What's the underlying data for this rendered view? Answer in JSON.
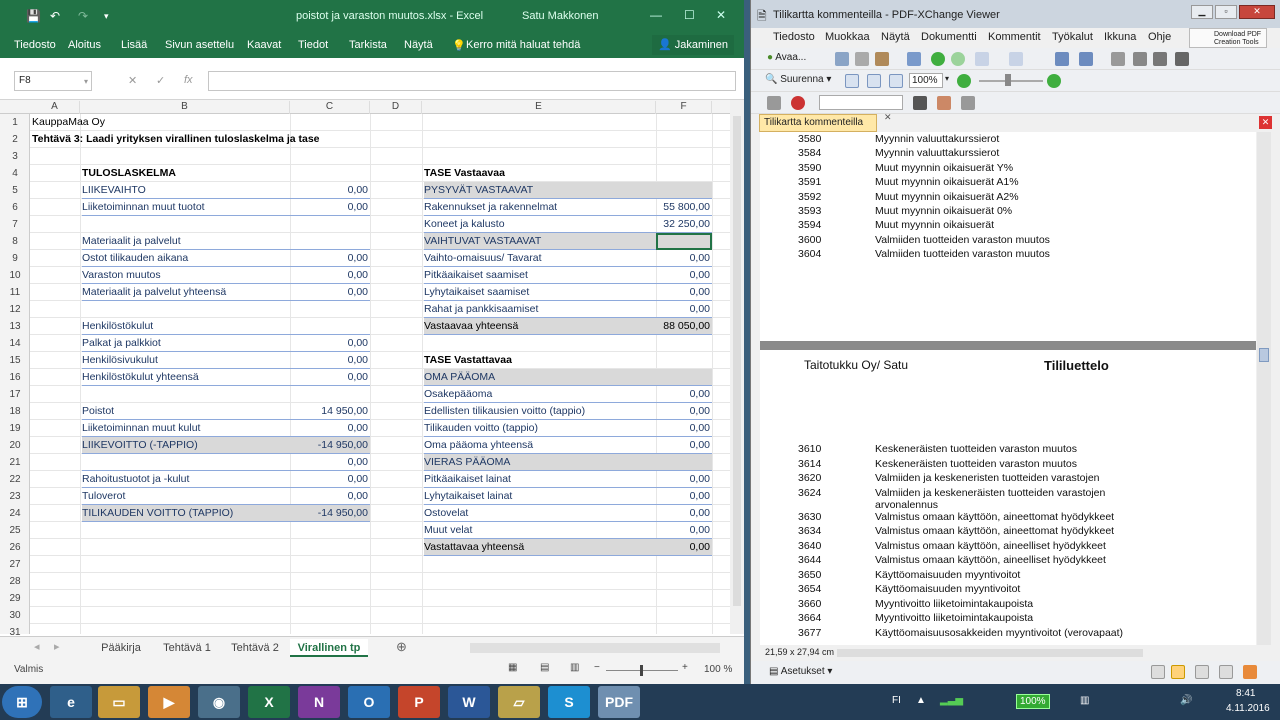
{
  "excel": {
    "title": "poistot ja varaston muutos.xlsx - Excel",
    "user": "Satu Makkonen",
    "ribbon_tabs": [
      "Tiedosto",
      "Aloitus",
      "Lisää",
      "Sivun asettelu",
      "Kaavat",
      "Tiedot",
      "Tarkista",
      "Näytä"
    ],
    "tell_me": "Kerro mitä haluat tehdä",
    "share": "Jakaminen",
    "name_box": "F8",
    "fx_label": "fx",
    "columns": [
      "A",
      "B",
      "C",
      "D",
      "E",
      "F"
    ],
    "rows": [
      "1",
      "2",
      "3",
      "4",
      "5",
      "6",
      "7",
      "8",
      "9",
      "10",
      "11",
      "12",
      "13",
      "14",
      "15",
      "16",
      "17",
      "18",
      "19",
      "20",
      "21",
      "22",
      "23",
      "24",
      "25",
      "26",
      "27",
      "28",
      "29",
      "30",
      "31"
    ],
    "a1": "KauppaMaa Oy",
    "a2": "Tehtävä 3: Laadi yrityksen virallinen tuloslaskelma ja tase",
    "income_header": "TULOSLASKELMA",
    "income": [
      {
        "label": "LIIKEVAIHTO",
        "value": "0,00"
      },
      {
        "label": "Liiketoiminnan muut tuotot",
        "value": "0,00"
      },
      {
        "label": "",
        "value": ""
      },
      {
        "label": "Materiaalit ja palvelut",
        "value": ""
      },
      {
        "label": "Ostot tilikauden aikana",
        "value": "0,00"
      },
      {
        "label": "Varaston muutos",
        "value": "0,00"
      },
      {
        "label": "Materiaalit ja palvelut yhteensä",
        "value": "0,00"
      },
      {
        "label": "",
        "value": ""
      },
      {
        "label": "Henkilöstökulut",
        "value": ""
      },
      {
        "label": "Palkat ja palkkiot",
        "value": "0,00"
      },
      {
        "label": "Henkilösivukulut",
        "value": "0,00"
      },
      {
        "label": "Henkilöstökulut yhteensä",
        "value": "0,00"
      },
      {
        "label": "",
        "value": ""
      },
      {
        "label": "Poistot",
        "value": "14 950,00"
      },
      {
        "label": "Liiketoiminnan muut kulut",
        "value": "0,00"
      },
      {
        "label": "LIIKEVOITTO (-TAPPIO)",
        "value": "-14 950,00"
      },
      {
        "label": "",
        "value": "0,00"
      },
      {
        "label": "Rahoitustuotot ja -kulut",
        "value": "0,00"
      },
      {
        "label": "Tuloverot",
        "value": "0,00"
      },
      {
        "label": "TILIKAUDEN VOITTO (TAPPIO)",
        "value": "-14 950,00"
      }
    ],
    "assets_header": "TASE Vastaavaa",
    "assets": [
      {
        "label": "PYSYVÄT VASTAAVAT",
        "value": ""
      },
      {
        "label": "Rakennukset ja rakennelmat",
        "value": "55 800,00"
      },
      {
        "label": "Koneet ja kalusto",
        "value": "32 250,00"
      },
      {
        "label": "VAIHTUVAT VASTAAVAT",
        "value": ""
      },
      {
        "label": "Vaihto-omaisuus/ Tavarat",
        "value": "0,00"
      },
      {
        "label": "Pitkäaikaiset saamiset",
        "value": "0,00"
      },
      {
        "label": "Lyhytaikaiset saamiset",
        "value": "0,00"
      },
      {
        "label": "Rahat ja pankkisaamiset",
        "value": "0,00"
      },
      {
        "label": "Vastaavaa yhteensä",
        "value": "88 050,00"
      }
    ],
    "liab_header": "TASE Vastattavaa",
    "liabilities": [
      {
        "label": "OMA PÄÄOMA",
        "value": ""
      },
      {
        "label": "Osakepääoma",
        "value": "0,00"
      },
      {
        "label": "Edellisten tilikausien voitto (tappio)",
        "value": "0,00"
      },
      {
        "label": "Tilikauden voitto (tappio)",
        "value": "0,00"
      },
      {
        "label": "Oma pääoma yhteensä",
        "value": "0,00"
      },
      {
        "label": "VIERAS PÄÄOMA",
        "value": ""
      },
      {
        "label": "Pitkäaikaiset lainat",
        "value": "0,00"
      },
      {
        "label": "Lyhytaikaiset lainat",
        "value": "0,00"
      },
      {
        "label": "Ostovelat",
        "value": "0,00"
      },
      {
        "label": "Muut velat",
        "value": "0,00"
      },
      {
        "label": "Vastattavaa yhteensä",
        "value": "0,00"
      }
    ],
    "sheet_tabs": [
      "Pääkirja",
      "Tehtävä 1",
      "Tehtävä 2",
      "Virallinen tp"
    ],
    "status": "Valmis",
    "zoom": "100 %"
  },
  "pdf": {
    "title": "Tilikartta kommenteilla - PDF-XChange Viewer",
    "menus": [
      "Tiedosto",
      "Muokkaa",
      "Näytä",
      "Dokumentti",
      "Kommentit",
      "Työkalut",
      "Ikkuna",
      "Ohje"
    ],
    "download": "Download PDF Creation Tools",
    "open_label": "Avaa...",
    "zoom_in_label": "Suurenna",
    "zoom_value": "100%",
    "doc_tab": "Tilikartta kommenteilla",
    "page1_accounts": [
      {
        "no": "3580",
        "name": "Myynnin valuuttakurssierot"
      },
      {
        "no": "3584",
        "name": "Myynnin valuuttakurssierot"
      },
      {
        "no": "3590",
        "name": "Muut myynnin oikaisuerät Y%"
      },
      {
        "no": "3591",
        "name": "Muut myynnin oikaisuerät A1%"
      },
      {
        "no": "3592",
        "name": "Muut myynnin oikaisuerät A2%"
      },
      {
        "no": "3593",
        "name": "Muut myynnin oikaisuerät 0%"
      },
      {
        "no": "3594",
        "name": "Muut myynnin oikaisuerät"
      },
      {
        "no": "3600",
        "name": "Valmiiden tuotteiden varaston muutos"
      },
      {
        "no": "3604",
        "name": "Valmiiden tuotteiden varaston muutos"
      }
    ],
    "page2_company": "Taitotukku Oy/ Satu",
    "page2_heading": "Tililuettelo",
    "page2_accounts": [
      {
        "no": "3610",
        "name": "Keskeneräisten tuotteiden varaston muutos"
      },
      {
        "no": "3614",
        "name": "Keskeneräisten tuotteiden varaston muutos"
      },
      {
        "no": "3620",
        "name": "Valmiiden ja keskeneristen tuotteiden varastojen"
      },
      {
        "no": "3624",
        "name": "Valmiiden ja keskeneräisten tuotteiden varastojen arvonalennus"
      },
      {
        "no": "3630",
        "name": "Valmistus omaan käyttöön, aineettomat hyödykkeet"
      },
      {
        "no": "3634",
        "name": "Valmistus omaan käyttöön, aineettomat hyödykkeet"
      },
      {
        "no": "3640",
        "name": "Valmistus omaan käyttöön, aineelliset hyödykkeet"
      },
      {
        "no": "3644",
        "name": "Valmistus omaan käyttöön, aineelliset hyödykkeet"
      },
      {
        "no": "3650",
        "name": "Käyttöomaisuuden myyntivoitot"
      },
      {
        "no": "3654",
        "name": "Käyttöomaisuuden myyntivoitot"
      },
      {
        "no": "3660",
        "name": "Myyntivoitto liiketoimintakaupoista"
      },
      {
        "no": "3664",
        "name": "Myyntivoitto liiketoimintakaupoista"
      },
      {
        "no": "3677",
        "name": "Käyttöomaisuusosakkeiden myyntivoitot (verovapaat)"
      }
    ],
    "page_size": "21,59 x 27,94 cm",
    "settings": "Asetukset"
  },
  "taskbar": {
    "lang": "FI",
    "battery": "100%",
    "time": "8:41",
    "date": "4.11.2016"
  },
  "colors": {
    "excel_green": "#217346",
    "header_blue": "#1f3864",
    "highlight_gray": "#d9d9d9"
  }
}
